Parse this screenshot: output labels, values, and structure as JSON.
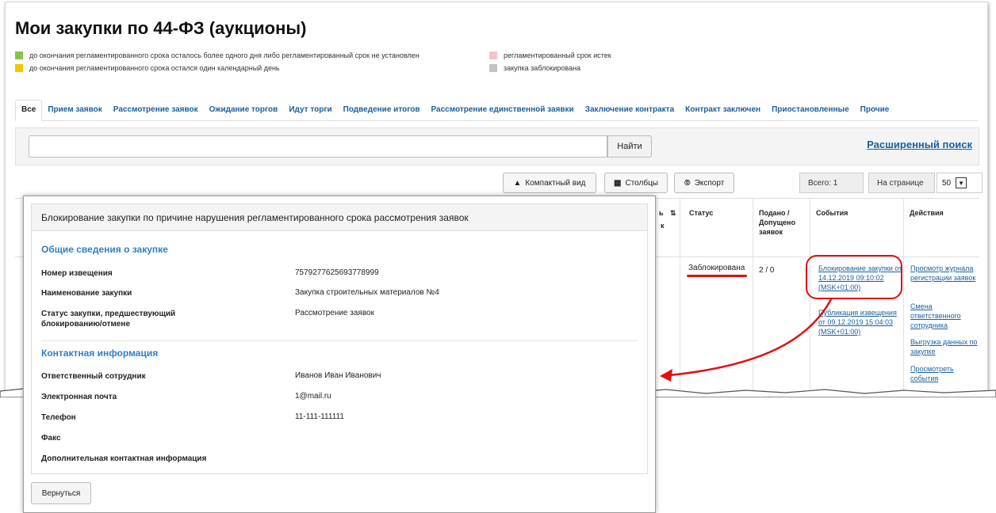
{
  "page": {
    "title": "Мои закупки по 44-ФЗ (аукционы)"
  },
  "legend": [
    {
      "color": "#8bc34a",
      "text": "до окончания регламентированного срока осталось более одного дня либо регламентированный срок не установлен"
    },
    {
      "color": "#f5c400",
      "text": "до окончания регламентированного срока остался один календарный день"
    },
    {
      "color": "#f6c3cc",
      "text": "регламентированный срок истек"
    },
    {
      "color": "#c4c4c4",
      "text": "закупка заблокирована"
    }
  ],
  "tabs": [
    {
      "label": "Все",
      "active": true
    },
    {
      "label": "Прием заявок"
    },
    {
      "label": "Рассмотрение заявок"
    },
    {
      "label": "Ожидание торгов"
    },
    {
      "label": "Идут торги"
    },
    {
      "label": "Подведение итогов"
    },
    {
      "label": "Рассмотрение единственной заявки"
    },
    {
      "label": "Заключение контракта"
    },
    {
      "label": "Контракт заключен"
    },
    {
      "label": "Приостановленные"
    },
    {
      "label": "Прочие"
    }
  ],
  "search": {
    "placeholder": "",
    "button_label": "Найти",
    "advanced_label": "Расширенный поиск"
  },
  "toolbar": {
    "compact_label": "Компактный вид",
    "columns_label": "Столбцы",
    "export_label": "Экспорт",
    "total_label": "Всего: 1",
    "per_page_label": "На странице",
    "per_page_value": "50"
  },
  "table": {
    "headers": {
      "partial": "ь",
      "partial2": "к",
      "sort_icon": "sort-icon",
      "status": "Статус",
      "submitted": "Подано / Допущено заявок",
      "events": "События",
      "actions": "Действия"
    },
    "row": {
      "status": "Заблокирована",
      "counts": "2 / 0",
      "events": [
        "Блокирование закупки от 14.12.2019 09:10:02 (MSK+01:00)",
        "Публикация извещения от 09.12.2019 15:04:03 (MSK+01:00)"
      ],
      "actions": [
        "Просмотр журнала регистрации заявок",
        "Смена ответственного сотрудника",
        "Выгрузка данных по закупке",
        "Просмотреть события"
      ]
    }
  },
  "modal": {
    "title": "Блокирование закупки по причине нарушения регламентированного срока рассмотрения заявок",
    "general_section": "Общие сведения о закупке",
    "fields": [
      {
        "label": "Номер извещения",
        "value": "7579277625693778999"
      },
      {
        "label": "Наименование закупки",
        "value": "Закупка строительных материалов №4"
      },
      {
        "label": "Статус закупки, предшествующий блокированию/отмене",
        "value": "Рассмотрение заявок"
      }
    ],
    "contact_section": "Контактная информация",
    "contacts": [
      {
        "label": "Ответственный сотрудник",
        "value": "Иванов Иван Иванович"
      },
      {
        "label": "Электронная почта",
        "value": "1@mail.ru"
      },
      {
        "label": "Телефон",
        "value": "11-111-111111"
      },
      {
        "label": "Факс",
        "value": ""
      },
      {
        "label": "Дополнительная контактная информация",
        "value": ""
      }
    ],
    "back_label": "Вернуться"
  },
  "colors": {
    "link": "#1a5f9e",
    "section": "#2f7fc6",
    "annotation": "#e01010"
  }
}
